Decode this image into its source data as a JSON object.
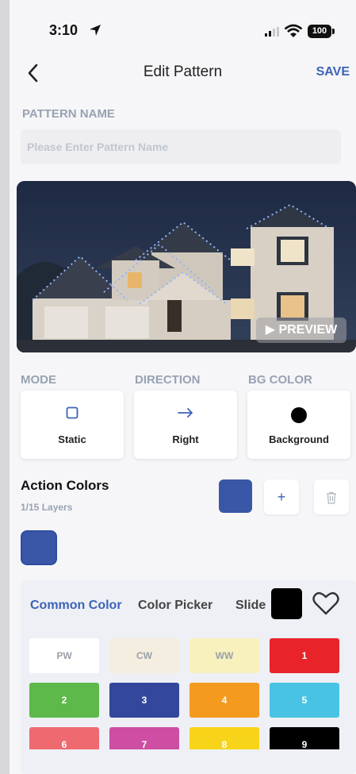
{
  "status_bar": {
    "time": "3:10",
    "battery": "100"
  },
  "nav": {
    "title": "Edit Pattern",
    "save_label": "SAVE"
  },
  "pattern_name": {
    "label": "PATTERN NAME",
    "value": "",
    "placeholder": "Please Enter Pattern Name"
  },
  "preview": {
    "button_label": "PREVIEW"
  },
  "options": [
    {
      "label": "MODE",
      "value": "Static",
      "icon": "square-outline-icon"
    },
    {
      "label": "DIRECTION",
      "value": "Right",
      "icon": "arrow-right-icon"
    },
    {
      "label": "BG COLOR",
      "value": "Background",
      "icon": "black-dot-icon"
    }
  ],
  "action_colors": {
    "title": "Action Colors",
    "layers": "1/15 Layers",
    "current_color": "#3a56a6",
    "add_label": "+",
    "delete_icon": "trash-icon"
  },
  "color_panel": {
    "tabs": [
      "Common Color",
      "Color Picker",
      "Slide"
    ],
    "active_tab": "Common Color",
    "swatches": [
      {
        "label": "PW",
        "bg": "#ffffff",
        "fg": "#9aa0a8"
      },
      {
        "label": "CW",
        "bg": "#f4eee0",
        "fg": "#9aa0a8"
      },
      {
        "label": "WW",
        "bg": "#f8f0bd",
        "fg": "#9aa0a8"
      },
      {
        "label": "1",
        "bg": "#e8232a",
        "fg": "#ffffff"
      },
      {
        "label": "2",
        "bg": "#5cb94a",
        "fg": "#ffffff"
      },
      {
        "label": "3",
        "bg": "#33489c",
        "fg": "#ffffff"
      },
      {
        "label": "4",
        "bg": "#f49a1f",
        "fg": "#ffffff"
      },
      {
        "label": "5",
        "bg": "#49c3e3",
        "fg": "#ffffff"
      },
      {
        "label": "6",
        "bg": "#ee6a70",
        "fg": "#ffffff"
      },
      {
        "label": "7",
        "bg": "#cd4ea3",
        "fg": "#ffffff"
      },
      {
        "label": "8",
        "bg": "#f7d419",
        "fg": "#ffffff"
      },
      {
        "label": "9",
        "bg": "#000000",
        "fg": "#ffffff"
      }
    ]
  },
  "colors": {
    "accent": "#3c63b7",
    "muted": "#98a2b3"
  }
}
